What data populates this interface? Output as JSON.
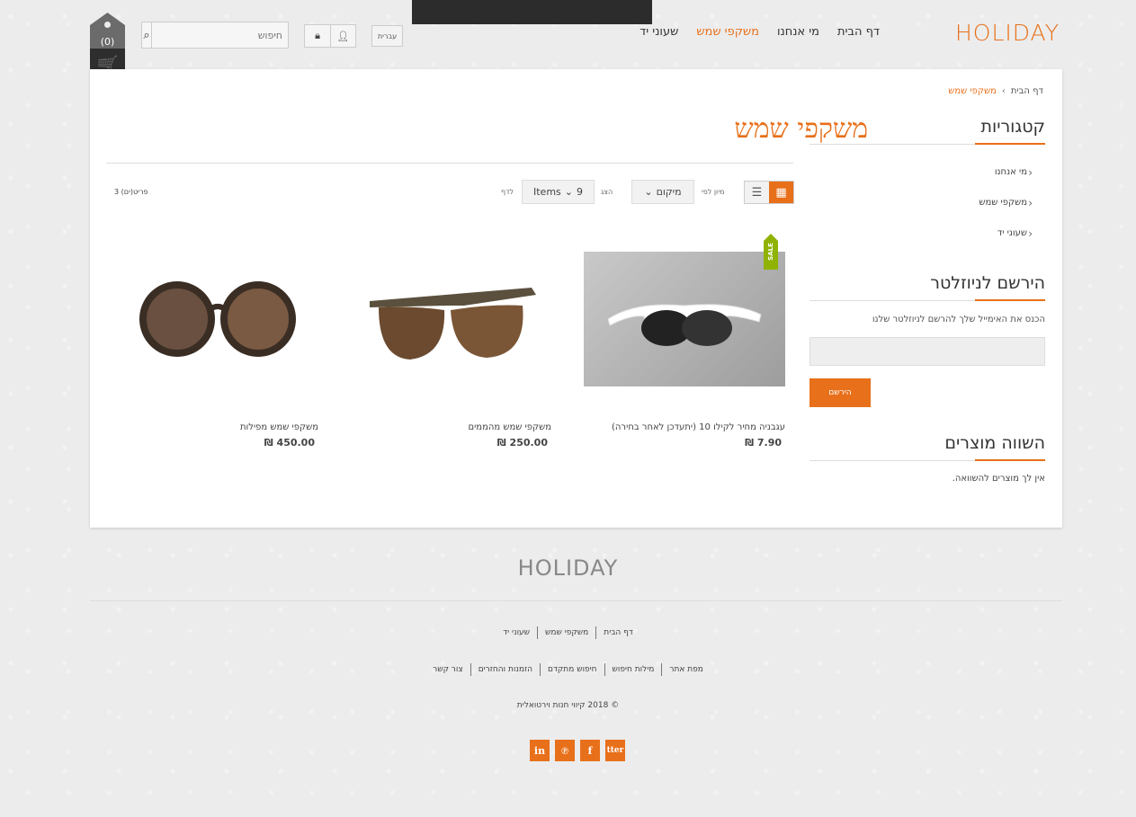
{
  "header": {
    "logo_text": "HOLIDAY",
    "nav": [
      "דף הבית",
      "מי אנחנו",
      "משקפי שמש",
      "שעוני יד"
    ],
    "nav_active": "משקפי שמש",
    "lang_label": "עברית",
    "search_placeholder": "חיפוש",
    "cart_count": "(0)"
  },
  "breadcrumb": {
    "home": "דף הבית",
    "current": "משקפי שמש"
  },
  "page_title": "משקפי שמש",
  "toolbar": {
    "sort_label": "מיון לפי",
    "sort_value": "מיקום",
    "show_label": "הצג",
    "items_value": "9",
    "items_label": "Items",
    "per_page_label": "לדף",
    "count_text": "3 פריט(ים)"
  },
  "products": [
    {
      "name": "עגבניה מחיר לקילו 10 (יתעדכן לאחר בחירה)",
      "price": "₪ 7.90",
      "badge": "SALE"
    },
    {
      "name": "משקפי שמש מהממים",
      "price": "₪ 250.00"
    },
    {
      "name": "משקפי שמש מפילות",
      "price": "₪ 450.00"
    }
  ],
  "sidebar": {
    "categories_title": "קטגוריות",
    "categories": [
      "מי אנחנו",
      "משקפי שמש",
      "שעוני יד"
    ],
    "newsletter_title": "הירשם לניוזלטר",
    "newsletter_text": "הכנס את האימייל שלך להרשם לניוזלטר שלנו",
    "newsletter_button": "הירשם",
    "compare_title": "השווה מוצרים",
    "compare_text": "אין לך מוצרים להשוואה."
  },
  "footer": {
    "logo_text": "HOLIDAY",
    "row1": [
      "דף הבית",
      "משקפי שמש",
      "שעוני יד"
    ],
    "row2": [
      "מפת אתר",
      "מילות חיפוש",
      "חיפוש מתקדם",
      "הזמנות והחזרים",
      "צור קשר"
    ],
    "copyright": "© 2018 קיווי חנות וירטואלית",
    "social": [
      "in",
      "℗",
      "f",
      "tter"
    ]
  },
  "colors": {
    "accent": "#e8701a",
    "sale": "#8fb300"
  }
}
